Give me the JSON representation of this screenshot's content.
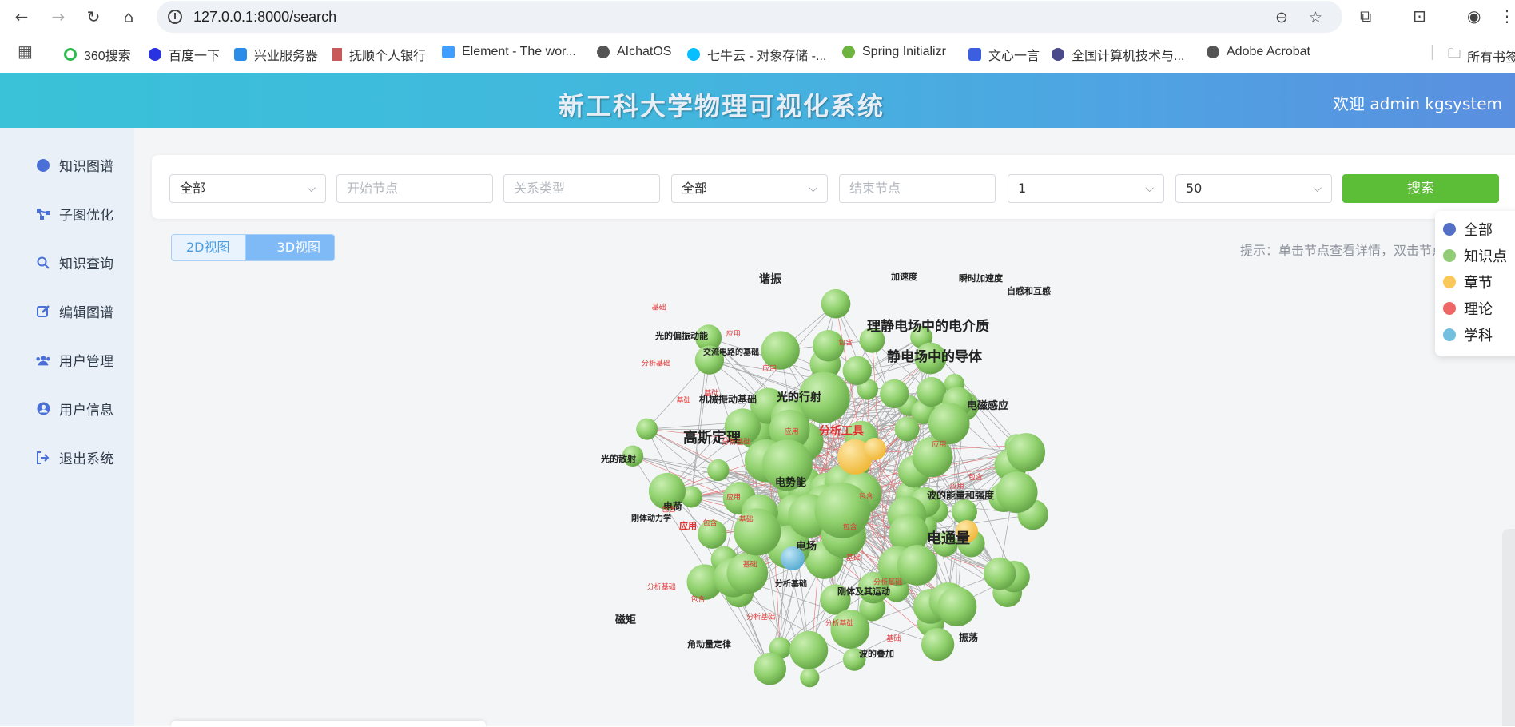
{
  "browser": {
    "url": "127.0.0.1:8000/search",
    "bookmarks": [
      {
        "label": "360搜索",
        "color": "#2dbb4f"
      },
      {
        "label": "百度一下",
        "color": "#2932e1"
      },
      {
        "label": "兴业服务器",
        "color": "#2b8be8"
      },
      {
        "label": "抚顺个人银行",
        "color": "#c85a5a"
      },
      {
        "label": "Element - The wor...",
        "color": "#409eff"
      },
      {
        "label": "AIchatOS",
        "color": "#555555"
      },
      {
        "label": "七牛云 - 对象存储 -...",
        "color": "#07beff"
      },
      {
        "label": "Spring Initializr",
        "color": "#6db33f"
      },
      {
        "label": "文心一言",
        "color": "#3b5fe0"
      },
      {
        "label": "全国计算机技术与...",
        "color": "#4a4a8a"
      },
      {
        "label": "Adobe Acrobat",
        "color": "#555555"
      }
    ],
    "bookmarks_folder": "所有书签"
  },
  "app": {
    "title": "新工科大学物理可视化系统",
    "welcome": "欢迎 admin kgsystem"
  },
  "sidebar": {
    "items": [
      {
        "label": "知识图谱",
        "icon": "circle-icon"
      },
      {
        "label": "子图优化",
        "icon": "share-nodes-icon"
      },
      {
        "label": "知识查询",
        "icon": "search-icon"
      },
      {
        "label": "编辑图谱",
        "icon": "edit-icon"
      },
      {
        "label": "用户管理",
        "icon": "users-icon"
      },
      {
        "label": "用户信息",
        "icon": "user-circle-icon"
      },
      {
        "label": "退出系统",
        "icon": "sign-out-icon"
      }
    ]
  },
  "search": {
    "start_type": "全部",
    "start_node_placeholder": "开始节点",
    "relation_placeholder": "关系类型",
    "end_type": "全部",
    "end_node_placeholder": "结束节点",
    "depth": "1",
    "limit": "50",
    "button": "搜索"
  },
  "view": {
    "tab_2d": "2D视图",
    "tab_3d": "3D视图",
    "active": "3D视图",
    "hint": "提示：单击节点查看详情，双击节点"
  },
  "legend": {
    "items": [
      {
        "label": "全部",
        "color": "#5470c6"
      },
      {
        "label": "知识点",
        "color": "#91cc75"
      },
      {
        "label": "章节",
        "color": "#fac858"
      },
      {
        "label": "理论",
        "color": "#ee6666"
      },
      {
        "label": "学科",
        "color": "#73c0de"
      }
    ]
  },
  "graph": {
    "node_labels": [
      "谐振",
      "加速度",
      "瞬时加速度",
      "自感和互感",
      "理静电场中的电介质",
      "静电场中的导体",
      "光的偏振动能",
      "交流电路的基础",
      "光的行射",
      "电磁感应",
      "机械振动基础",
      "高斯定理",
      "分析工具",
      "光的散射",
      "电势能",
      "波的能量和强度",
      "电荷",
      "刚体动力学",
      "应用",
      "电通量",
      "电场",
      "分析基础",
      "磁矩",
      "刚体及其运动",
      "角动量定律",
      "振荡",
      "波的叠加"
    ],
    "link_labels": [
      "基础",
      "包含",
      "应用",
      "分析基础"
    ]
  }
}
